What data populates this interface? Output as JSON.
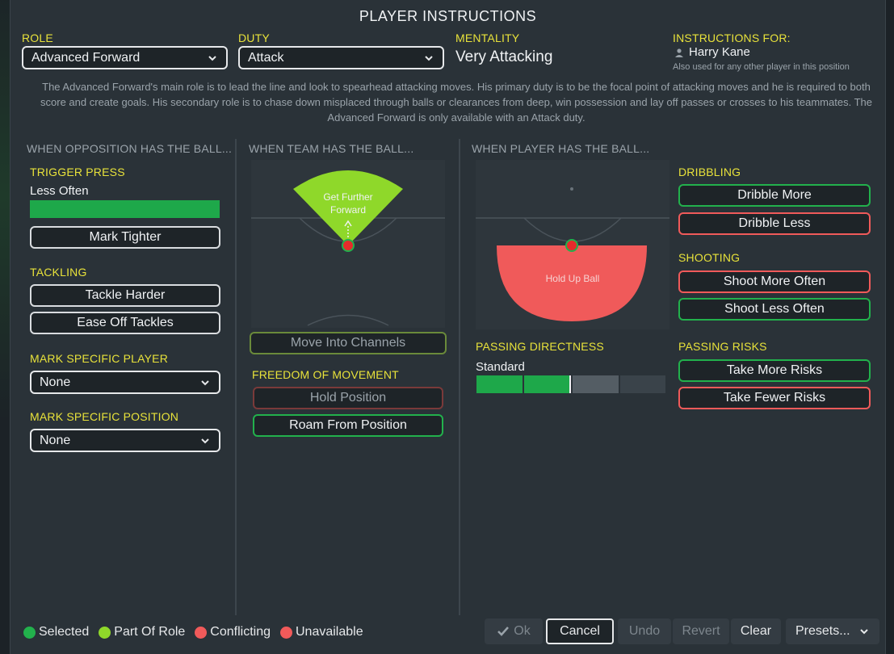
{
  "title": "PLAYER INSTRUCTIONS",
  "role": {
    "label": "ROLE",
    "value": "Advanced Forward"
  },
  "duty": {
    "label": "DUTY",
    "value": "Attack"
  },
  "mentality": {
    "label": "MENTALITY",
    "value": "Very Attacking"
  },
  "instructions_for": {
    "label": "INSTRUCTIONS FOR:",
    "player": "Harry Kane",
    "note": "Also used for any other player in this position"
  },
  "description": "The Advanced Forward's main role is to lead the line and look to spearhead attacking moves. His primary duty is to be the focal point of attacking moves and he is required to both score and create goals. His secondary role is to chase down misplaced through balls or clearances from deep, win possession and lay off passes or crosses to his teammates. The Advanced Forward is only available with an Attack duty.",
  "col1": {
    "header": "WHEN OPPOSITION HAS THE BALL...",
    "trigger_press": {
      "label": "TRIGGER PRESS",
      "value": "Less Often",
      "level": 1.0
    },
    "mark_tighter": "Mark Tighter",
    "tackling": {
      "label": "TACKLING",
      "harder": "Tackle Harder",
      "ease": "Ease Off Tackles"
    },
    "mark_player": {
      "label": "MARK SPECIFIC PLAYER",
      "value": "None"
    },
    "mark_position": {
      "label": "MARK SPECIFIC POSITION",
      "value": "None"
    }
  },
  "col2": {
    "header": "WHEN TEAM HAS THE BALL...",
    "pitch_label_1": "Get Further",
    "pitch_label_2": "Forward",
    "channels": "Move Into Channels",
    "freedom": {
      "label": "FREEDOM OF MOVEMENT",
      "hold": "Hold Position",
      "roam": "Roam From Position"
    }
  },
  "col3": {
    "header": "WHEN PLAYER HAS THE BALL...",
    "pitch_label": "Hold Up Ball",
    "passing_directness": {
      "label": "PASSING DIRECTNESS",
      "value": "Standard",
      "level": 0.5
    },
    "dribbling": {
      "label": "DRIBBLING",
      "more": "Dribble More",
      "less": "Dribble Less"
    },
    "shooting": {
      "label": "SHOOTING",
      "more": "Shoot More Often",
      "less": "Shoot Less Often"
    },
    "passing_risks": {
      "label": "PASSING RISKS",
      "more": "Take More Risks",
      "fewer": "Take Fewer Risks"
    }
  },
  "legend": {
    "selected": "Selected",
    "part_of_role": "Part Of Role",
    "conflicting": "Conflicting",
    "unavailable": "Unavailable"
  },
  "footer": {
    "ok": "Ok",
    "cancel": "Cancel",
    "undo": "Undo",
    "revert": "Revert",
    "clear": "Clear",
    "presets": "Presets..."
  },
  "colors": {
    "selected": "#22b14c",
    "part_of_role": "#8fd82a",
    "conflicting": "#f05a5a",
    "unavailable": "#f05a5a"
  }
}
